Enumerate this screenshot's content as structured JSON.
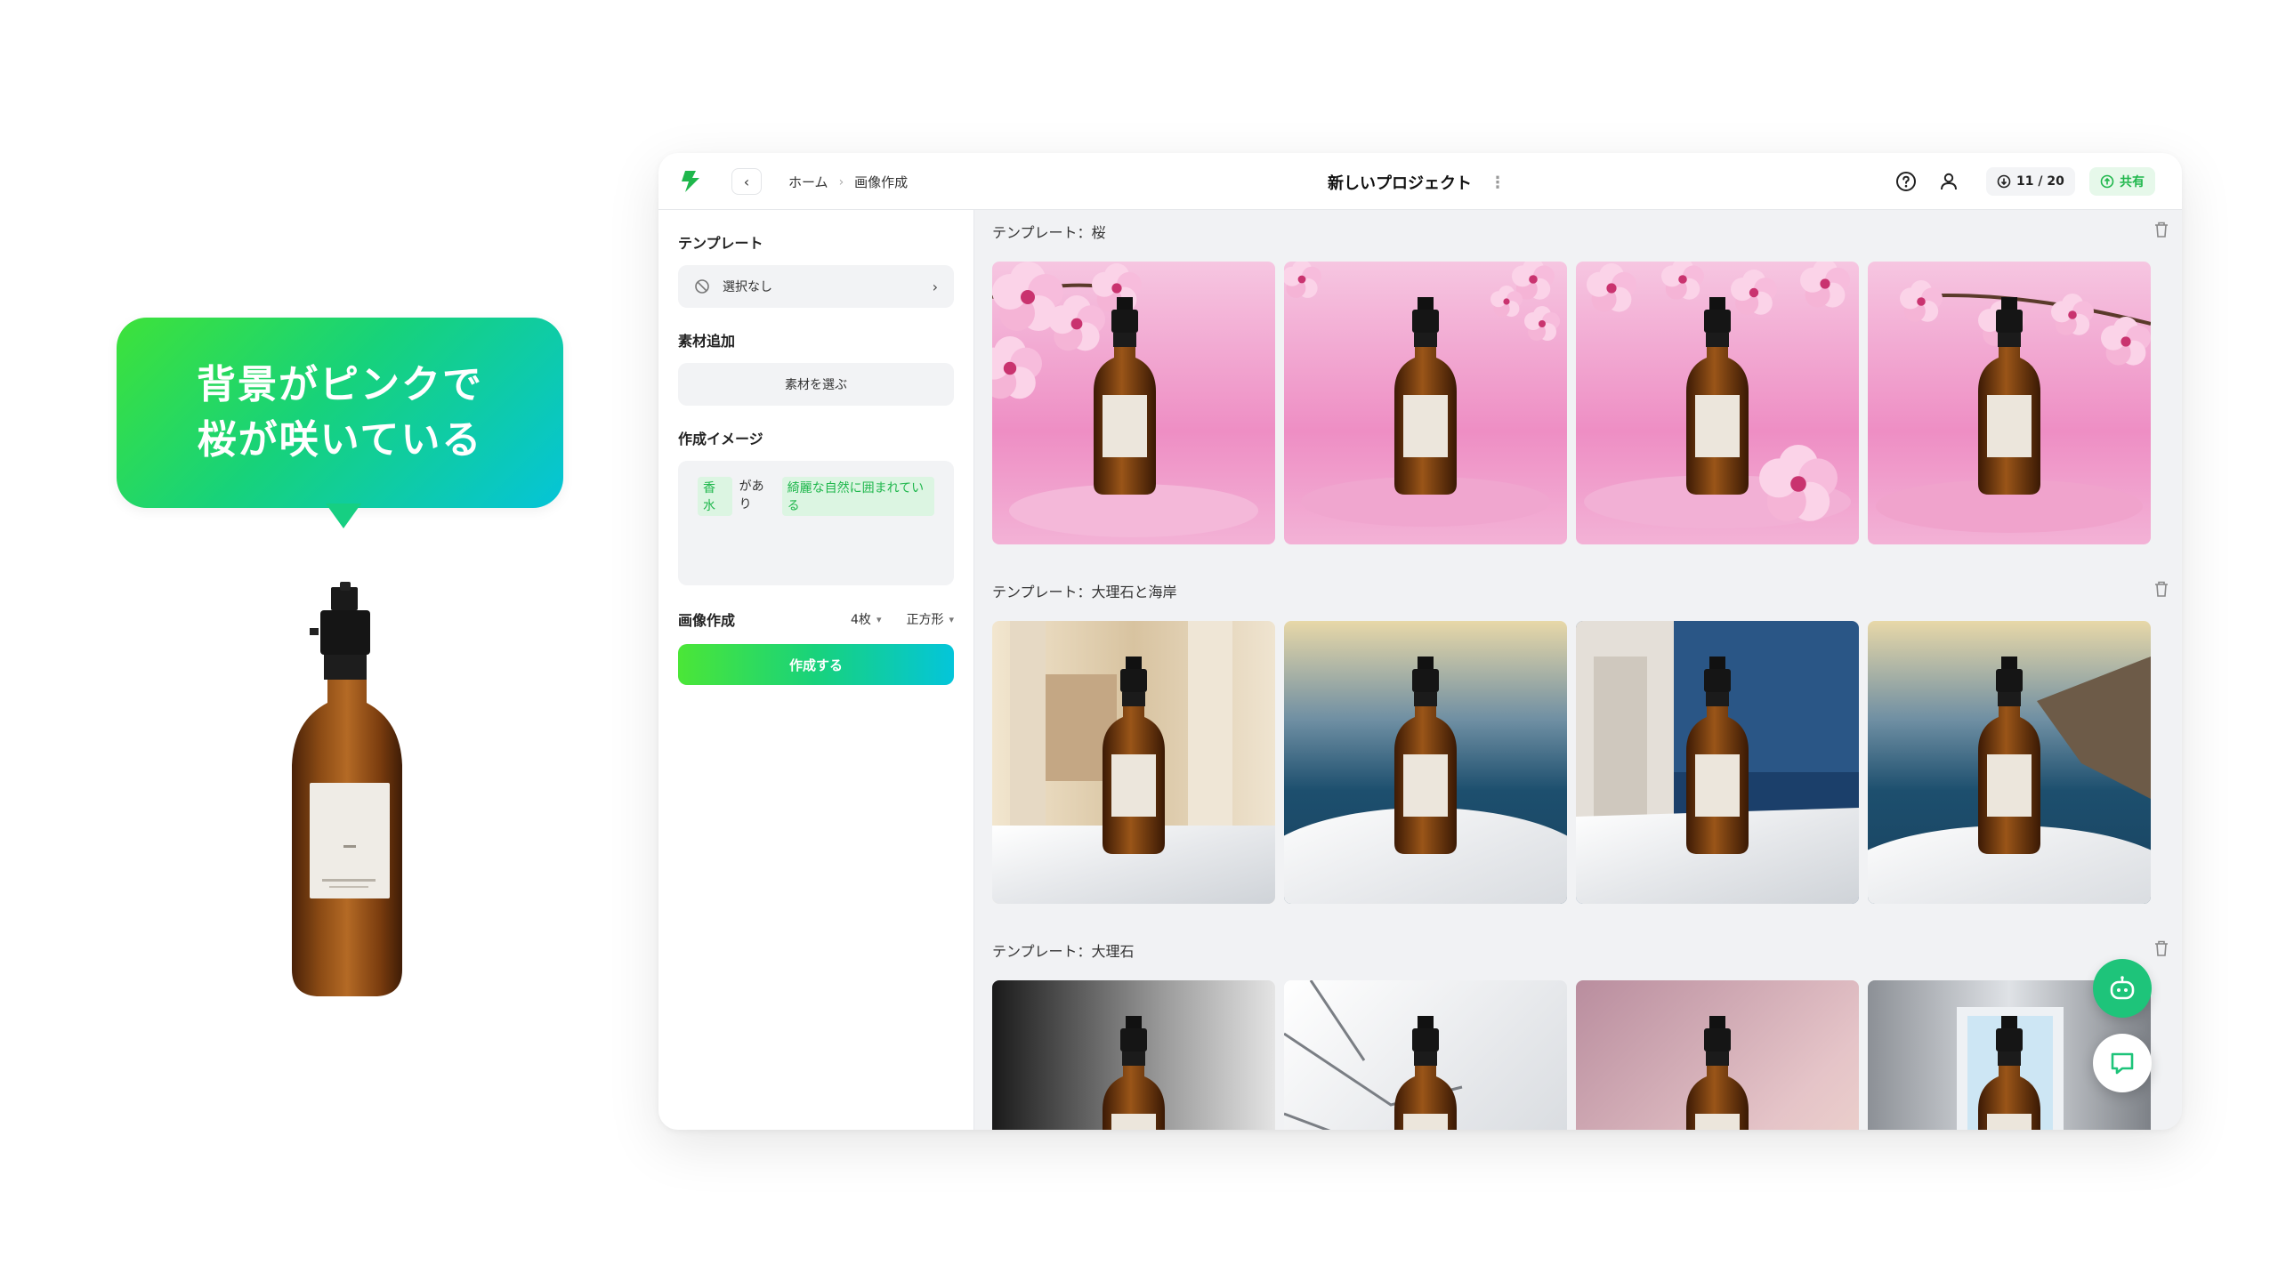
{
  "bubble": {
    "line1": "背景がピンクで",
    "line2": "桜が咲いている"
  },
  "header": {
    "breadcrumb": [
      "ホーム",
      "画像作成"
    ],
    "project_title": "新しいプロジェクト",
    "credits": "11 / 20",
    "share_label": "共有"
  },
  "sidebar": {
    "template_label": "テンプレート",
    "template_value": "選択なし",
    "material_label": "素材追加",
    "material_button": "素材を選ぶ",
    "image_label": "作成イメージ",
    "prompt_chip1": "香水",
    "prompt_text": "があり",
    "prompt_chip2": "綺麗な自然に囲まれている",
    "generate_label": "画像作成",
    "count_value": "4枚",
    "shape_value": "正方形",
    "create_button": "作成する"
  },
  "gallery": {
    "sections": [
      {
        "title": "テンプレート：桜"
      },
      {
        "title": "テンプレート：大理石と海岸"
      },
      {
        "title": "テンプレート：大理石"
      }
    ]
  },
  "colors": {
    "brand_green": "#1fb74c",
    "gradient_start": "#4be637",
    "gradient_end": "#04c5da"
  }
}
